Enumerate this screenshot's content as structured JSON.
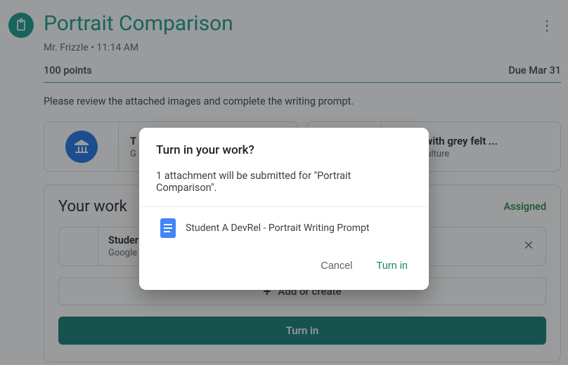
{
  "header": {
    "title": "Portrait Comparison",
    "author": "Mr. Frizzle",
    "separator": " • ",
    "time": "11:14 AM"
  },
  "meta": {
    "points": "100 points",
    "due": "Due Mar 31"
  },
  "description": "Please review the attached images and complete the writing prompt.",
  "attachments": [
    {
      "title": "T",
      "source": "G"
    },
    {
      "title": "ortrait with grey felt ...",
      "source": "Arts & Culture"
    }
  ],
  "work": {
    "heading": "Your work",
    "status": "Assigned",
    "file": {
      "title": "Studer",
      "subtitle": "Google"
    },
    "add_label": "Add or create",
    "turnin_label": "Turn in"
  },
  "dialog": {
    "title": "Turn in your work?",
    "body": "1 attachment will be submitted for \"Portrait Comparison\".",
    "attachment_name": "Student A DevRel - Portrait Writing Prompt",
    "cancel": "Cancel",
    "confirm": "Turn in"
  }
}
